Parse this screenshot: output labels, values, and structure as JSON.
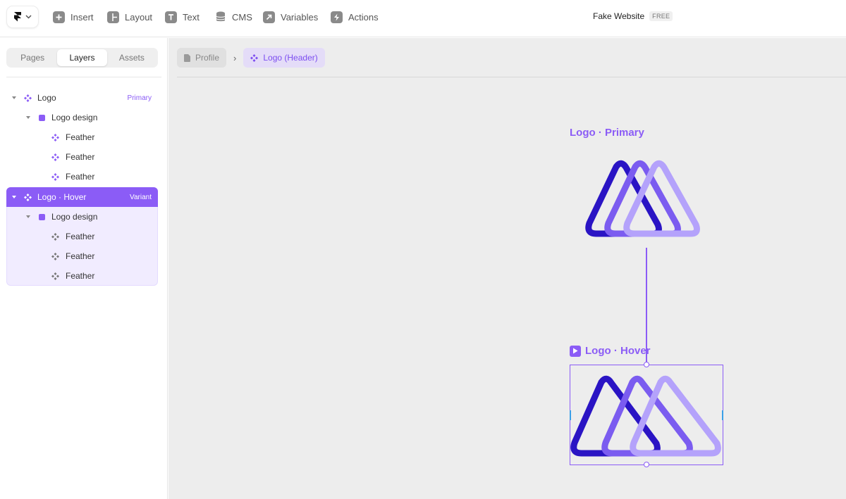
{
  "toolbar": {
    "items": [
      {
        "label": "Insert",
        "icon": "plus-square-icon"
      },
      {
        "label": "Layout",
        "icon": "layout-icon"
      },
      {
        "label": "Text",
        "icon": "text-icon"
      },
      {
        "label": "CMS",
        "icon": "database-icon"
      },
      {
        "label": "Variables",
        "icon": "arrow-up-right-icon"
      },
      {
        "label": "Actions",
        "icon": "lightning-icon"
      }
    ],
    "project_name": "Fake Website",
    "plan_badge": "FREE"
  },
  "left_panel": {
    "tabs": [
      "Pages",
      "Layers",
      "Assets"
    ],
    "active_tab": "Layers",
    "layers": [
      {
        "name": "Logo",
        "tag": "Primary",
        "icon": "component-icon"
      },
      {
        "name": "Logo design",
        "icon": "frame-icon"
      },
      {
        "name": "Feather",
        "icon": "component-instance-icon"
      },
      {
        "name": "Feather",
        "icon": "component-instance-icon"
      },
      {
        "name": "Feather",
        "icon": "component-instance-icon"
      },
      {
        "name": "Logo · Hover",
        "tag": "Variant",
        "icon": "component-icon",
        "selected": true
      },
      {
        "name": "Logo design",
        "icon": "frame-icon"
      },
      {
        "name": "Feather",
        "icon": "component-instance-icon"
      },
      {
        "name": "Feather",
        "icon": "component-instance-icon"
      },
      {
        "name": "Feather",
        "icon": "component-instance-icon"
      }
    ]
  },
  "canvas": {
    "breadcrumb": [
      {
        "label": "Profile",
        "icon": "page-icon"
      },
      {
        "label": "Logo (Header)",
        "icon": "component-icon"
      }
    ],
    "frames": [
      {
        "label": "Logo · Primary"
      },
      {
        "label": "Logo · Hover",
        "icon": "play-icon"
      }
    ]
  },
  "colors": {
    "accent": "#8b5cf6",
    "logo_dark": "#2a14c4",
    "logo_mid": "#7b5cf0",
    "logo_light": "#b4a2fb"
  }
}
